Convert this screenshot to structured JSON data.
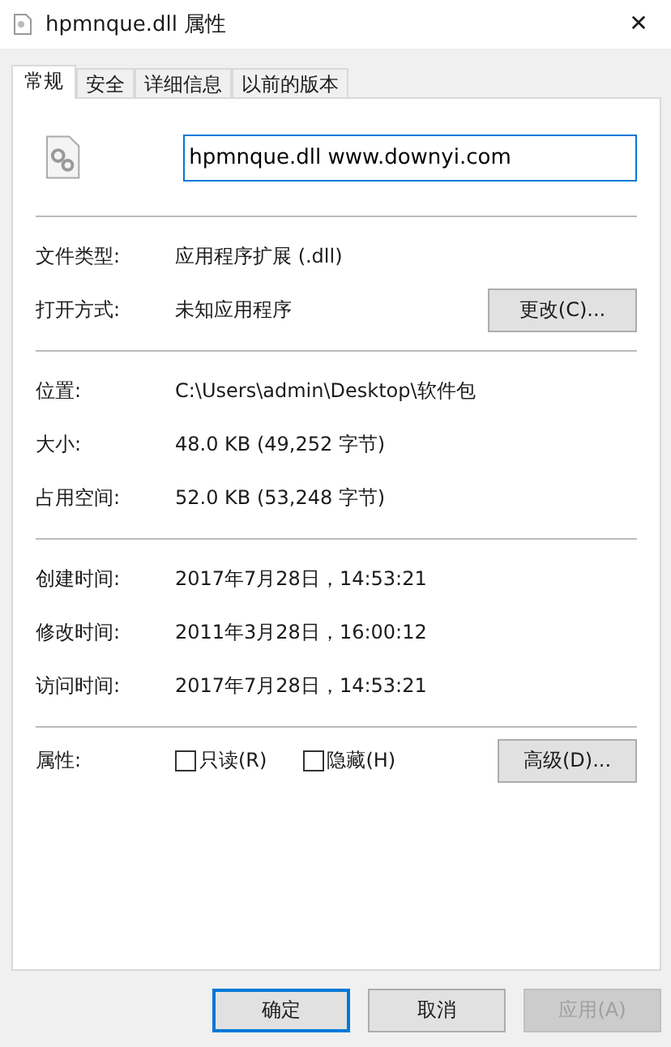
{
  "window": {
    "title": "hpmnque.dll 属性",
    "close": "✕"
  },
  "tabs": [
    {
      "label": "常规",
      "selected": true
    },
    {
      "label": "安全",
      "selected": false
    },
    {
      "label": "详细信息",
      "selected": false
    },
    {
      "label": "以前的版本",
      "selected": false
    }
  ],
  "file_name": {
    "value": "hpmnque.dll www.downyi.com"
  },
  "sections": [
    [
      {
        "label": "文件类型:",
        "value": "应用程序扩展 (.dll)"
      },
      {
        "label": "打开方式:",
        "value": "未知应用程序",
        "button": "更改(C)..."
      }
    ],
    [
      {
        "label": "位置:",
        "value": "C:\\Users\\admin\\Desktop\\软件包"
      },
      {
        "label": "大小:",
        "value": "48.0 KB (49,252 字节)"
      },
      {
        "label": "占用空间:",
        "value": "52.0 KB (53,248 字节)"
      }
    ],
    [
      {
        "label": "创建时间:",
        "value": "2017年7月28日，14:53:21"
      },
      {
        "label": "修改时间:",
        "value": "2011年3月28日，16:00:12"
      },
      {
        "label": "访问时间:",
        "value": "2017年7月28日，14:53:21"
      }
    ]
  ],
  "attributes": {
    "label": "属性:",
    "checkboxes": [
      {
        "label": "只读(R)",
        "checked": false
      },
      {
        "label": "隐藏(H)",
        "checked": false
      }
    ],
    "button": "高级(D)..."
  },
  "buttons": [
    {
      "label": "确定",
      "default": true,
      "disabled": false
    },
    {
      "label": "取消",
      "default": false,
      "disabled": false
    },
    {
      "label": "应用(A)",
      "default": false,
      "disabled": true
    }
  ]
}
